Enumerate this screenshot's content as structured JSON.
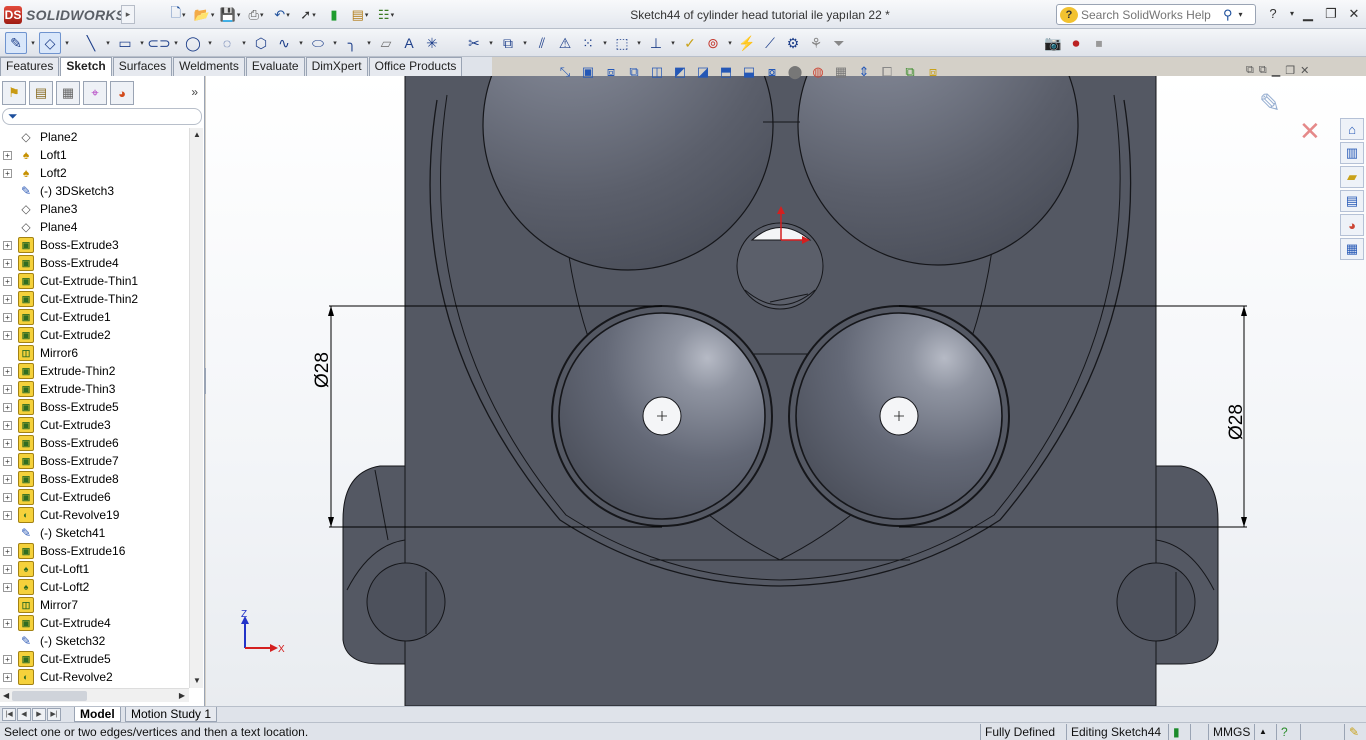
{
  "app": {
    "brand": "SOLIDWORKS",
    "document_title": "Sketch44 of cylinder head tutorial ile yapılan 22 *"
  },
  "help_search": {
    "placeholder": "Search SolidWorks Help"
  },
  "command_tabs": [
    {
      "label": "Features",
      "active": false
    },
    {
      "label": "Sketch",
      "active": true
    },
    {
      "label": "Surfaces",
      "active": false
    },
    {
      "label": "Weldments",
      "active": false
    },
    {
      "label": "Evaluate",
      "active": false
    },
    {
      "label": "DimXpert",
      "active": false
    },
    {
      "label": "Office Products",
      "active": false
    }
  ],
  "feature_tree": [
    {
      "label": "Plane2",
      "icon": "plane-icon",
      "expandable": false
    },
    {
      "label": "Loft1",
      "icon": "loft-icon",
      "expandable": true
    },
    {
      "label": "Loft2",
      "icon": "loft-icon",
      "expandable": true
    },
    {
      "label": "(-) 3DSketch3",
      "icon": "3dsketch-icon",
      "expandable": false
    },
    {
      "label": "Plane3",
      "icon": "plane-icon",
      "expandable": false
    },
    {
      "label": "Plane4",
      "icon": "plane-icon",
      "expandable": false
    },
    {
      "label": "Boss-Extrude3",
      "icon": "extrude-icon",
      "expandable": true
    },
    {
      "label": "Boss-Extrude4",
      "icon": "extrude-icon",
      "expandable": true
    },
    {
      "label": "Cut-Extrude-Thin1",
      "icon": "cut-extrude-icon",
      "expandable": true
    },
    {
      "label": "Cut-Extrude-Thin2",
      "icon": "cut-extrude-icon",
      "expandable": true
    },
    {
      "label": "Cut-Extrude1",
      "icon": "cut-extrude-icon",
      "expandable": true
    },
    {
      "label": "Cut-Extrude2",
      "icon": "cut-extrude-icon",
      "expandable": true
    },
    {
      "label": "Mirror6",
      "icon": "mirror-icon",
      "expandable": false
    },
    {
      "label": "Extrude-Thin2",
      "icon": "extrude-icon",
      "expandable": true
    },
    {
      "label": "Extrude-Thin3",
      "icon": "extrude-icon",
      "expandable": true
    },
    {
      "label": "Boss-Extrude5",
      "icon": "extrude-icon",
      "expandable": true
    },
    {
      "label": "Cut-Extrude3",
      "icon": "cut-extrude-icon",
      "expandable": true
    },
    {
      "label": "Boss-Extrude6",
      "icon": "extrude-icon",
      "expandable": true
    },
    {
      "label": "Boss-Extrude7",
      "icon": "extrude-icon",
      "expandable": true
    },
    {
      "label": "Boss-Extrude8",
      "icon": "extrude-icon",
      "expandable": true
    },
    {
      "label": "Cut-Extrude6",
      "icon": "cut-extrude-icon",
      "expandable": true
    },
    {
      "label": "Cut-Revolve19",
      "icon": "revolve-icon",
      "expandable": true
    },
    {
      "label": "(-) Sketch41",
      "icon": "sketch-icon",
      "expandable": false
    },
    {
      "label": "Boss-Extrude16",
      "icon": "extrude-icon",
      "expandable": true
    },
    {
      "label": "Cut-Loft1",
      "icon": "cut-loft-icon",
      "expandable": true
    },
    {
      "label": "Cut-Loft2",
      "icon": "cut-loft-icon",
      "expandable": true
    },
    {
      "label": "Mirror7",
      "icon": "mirror-icon",
      "expandable": false
    },
    {
      "label": "Cut-Extrude4",
      "icon": "cut-extrude-icon",
      "expandable": true
    },
    {
      "label": "(-) Sketch32",
      "icon": "sketch-icon",
      "expandable": false
    },
    {
      "label": "Cut-Extrude5",
      "icon": "cut-extrude-icon",
      "expandable": true
    },
    {
      "label": "Cut-Revolve2",
      "icon": "revolve-icon",
      "expandable": true
    }
  ],
  "viewport": {
    "dimension_left": "Ø28",
    "dimension_right": "Ø28",
    "triad_z": "Z",
    "triad_x": "X",
    "colors": {
      "part_fill": "#545863",
      "edge": "#15161a",
      "dimension": "#000000"
    }
  },
  "bottom_tabs": [
    {
      "label": "Model",
      "active": true
    },
    {
      "label": "Motion Study 1",
      "active": false
    }
  ],
  "status": {
    "message": "Select one or two edges/vertices and then a text location.",
    "definition": "Fully Defined",
    "editing": "Editing Sketch44",
    "units": "MMGS"
  }
}
